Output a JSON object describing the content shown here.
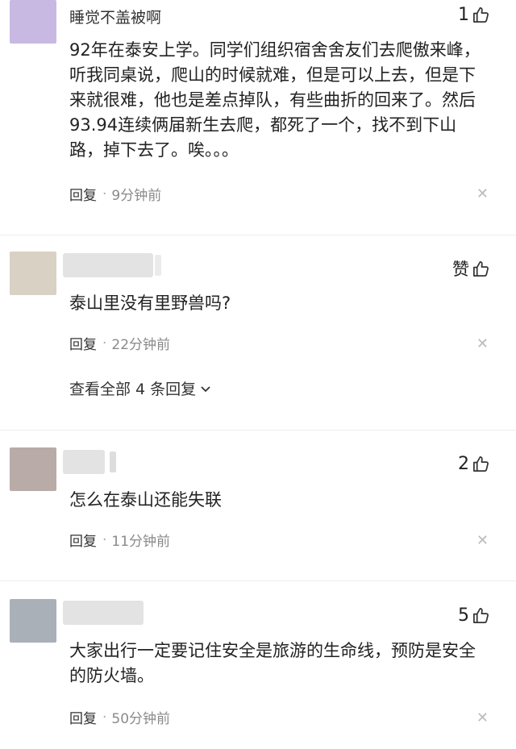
{
  "comments": [
    {
      "username": "睡觉不盖被啊",
      "avatar_color": "#c8b9e3",
      "like_count": "1",
      "text": "92年在泰安上学。同学们组织宿舍舍友们去爬傲来峰，听我同桌说，爬山的时候就难，但是可以上去，但是下来就很难，他也是差点掉队，有些曲折的回来了。然后93.94连续俩届新生去爬，都死了一个，找不到下山路，掉下去了。唉。。。",
      "reply_label": "回复",
      "time": "9分钟前"
    },
    {
      "avatar_color": "#d9d1c4",
      "like_label": "赞",
      "text": "泰山里没有里野兽吗?",
      "reply_label": "回复",
      "time": "22分钟前",
      "view_replies": "查看全部 4 条回复"
    },
    {
      "avatar_color": "#b9aba8",
      "like_count": "2",
      "text": "怎么在泰山还能失联",
      "reply_label": "回复",
      "time": "11分钟前"
    },
    {
      "avatar_color": "#a9b0b8",
      "like_count": "5",
      "text": "大家出行一定要记住安全是旅游的生命线，预防是安全的防火墙。",
      "reply_label": "回复",
      "time": "50分钟前"
    }
  ],
  "icons": {
    "like": "thumbs-up-icon",
    "close": "close-icon",
    "expand": "chevron-down-icon"
  },
  "colors": {
    "text": "#222222",
    "meta": "#8a8a8a",
    "blur": "#e3e3e3"
  }
}
